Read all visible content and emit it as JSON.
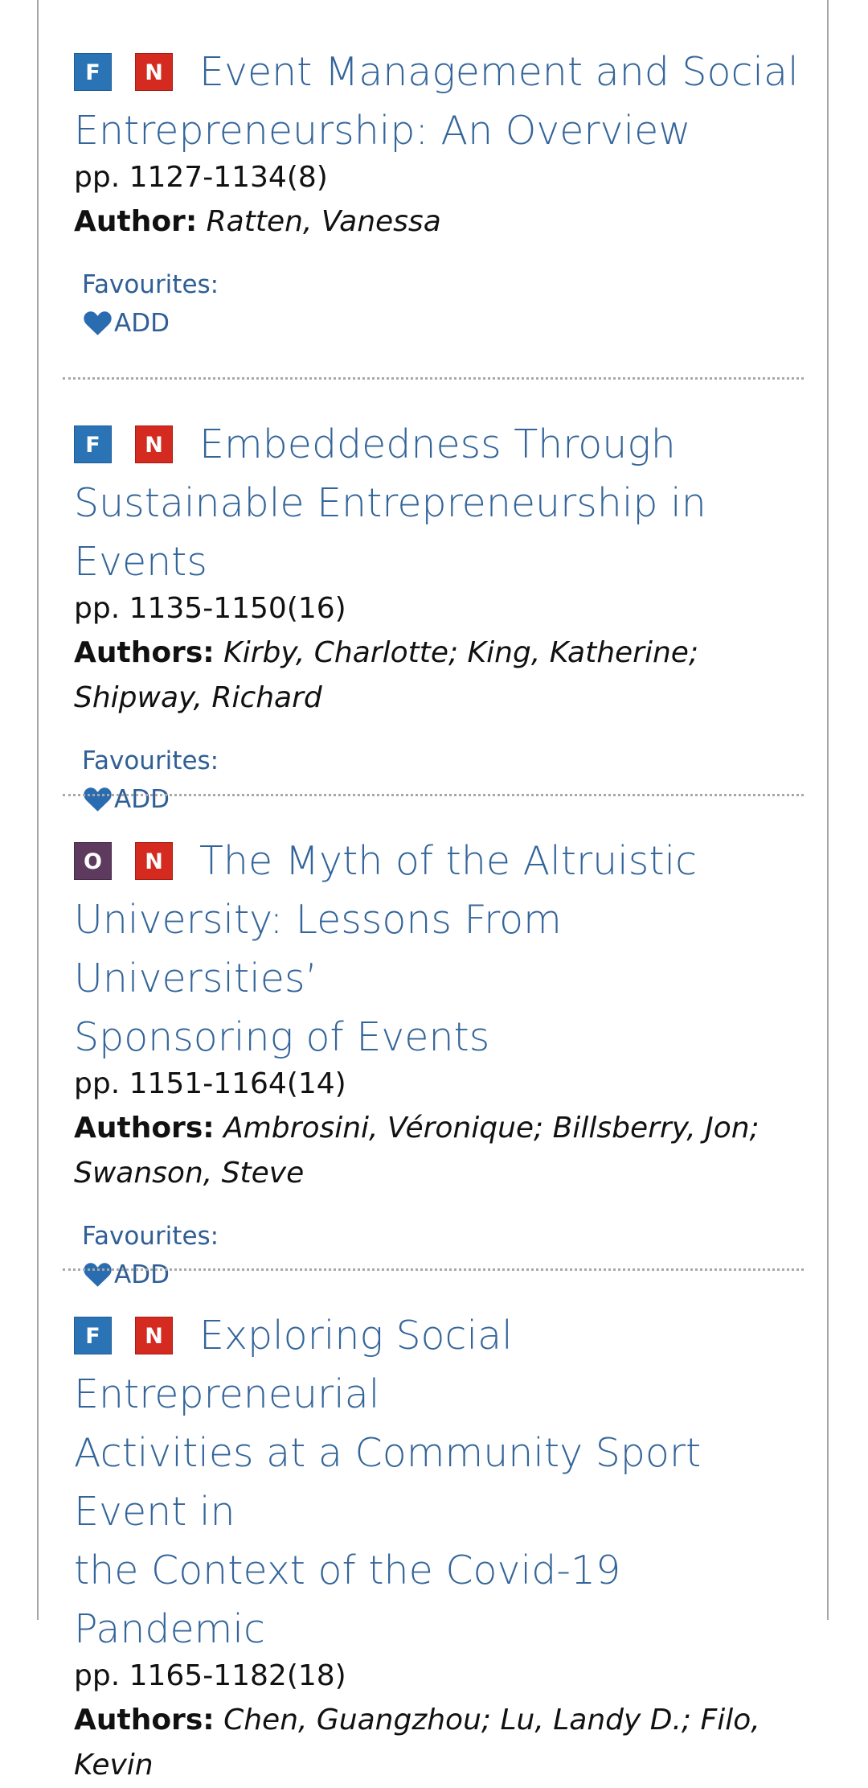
{
  "favourites_label": "Favourites:",
  "add_label": "ADD",
  "colors": {
    "title": "#34659a",
    "badge_free": "#2a74b6",
    "badge_new": "#d42a1f",
    "badge_open": "#5e3a5f",
    "favourites": "#2f5f96"
  },
  "articles": [
    {
      "badges": [
        "F",
        "N"
      ],
      "title_lines": [
        "Event Management and Social",
        "Entrepreneurship: An Overview"
      ],
      "pages": "pp. 1127-1134(8)",
      "author_label": "Author:",
      "author_lines": [
        "Ratten, Vanessa"
      ]
    },
    {
      "badges": [
        "F",
        "N"
      ],
      "title_lines": [
        "Embeddedness Through",
        "Sustainable Entrepreneurship in Events"
      ],
      "pages": "pp. 1135-1150(16)",
      "author_label": "Authors:",
      "author_lines": [
        "Kirby, Charlotte; King, Katherine;",
        "Shipway, Richard"
      ]
    },
    {
      "badges": [
        "O",
        "N"
      ],
      "title_lines": [
        "The Myth of the Altruistic",
        "University: Lessons From Universities’",
        "Sponsoring of Events"
      ],
      "pages": "pp. 1151-1164(14)",
      "author_label": "Authors:",
      "author_lines": [
        "Ambrosini, Véronique; Billsberry, Jon;",
        "Swanson, Steve"
      ]
    },
    {
      "badges": [
        "F",
        "N"
      ],
      "title_lines": [
        "Exploring Social Entrepreneurial",
        "Activities at a Community Sport Event in",
        "the Context of the Covid-19 Pandemic"
      ],
      "pages": "pp. 1165-1182(18)",
      "author_label": "Authors:",
      "author_lines": [
        "Chen, Guangzhou; Lu, Landy D.; Filo,",
        "Kevin"
      ]
    }
  ]
}
